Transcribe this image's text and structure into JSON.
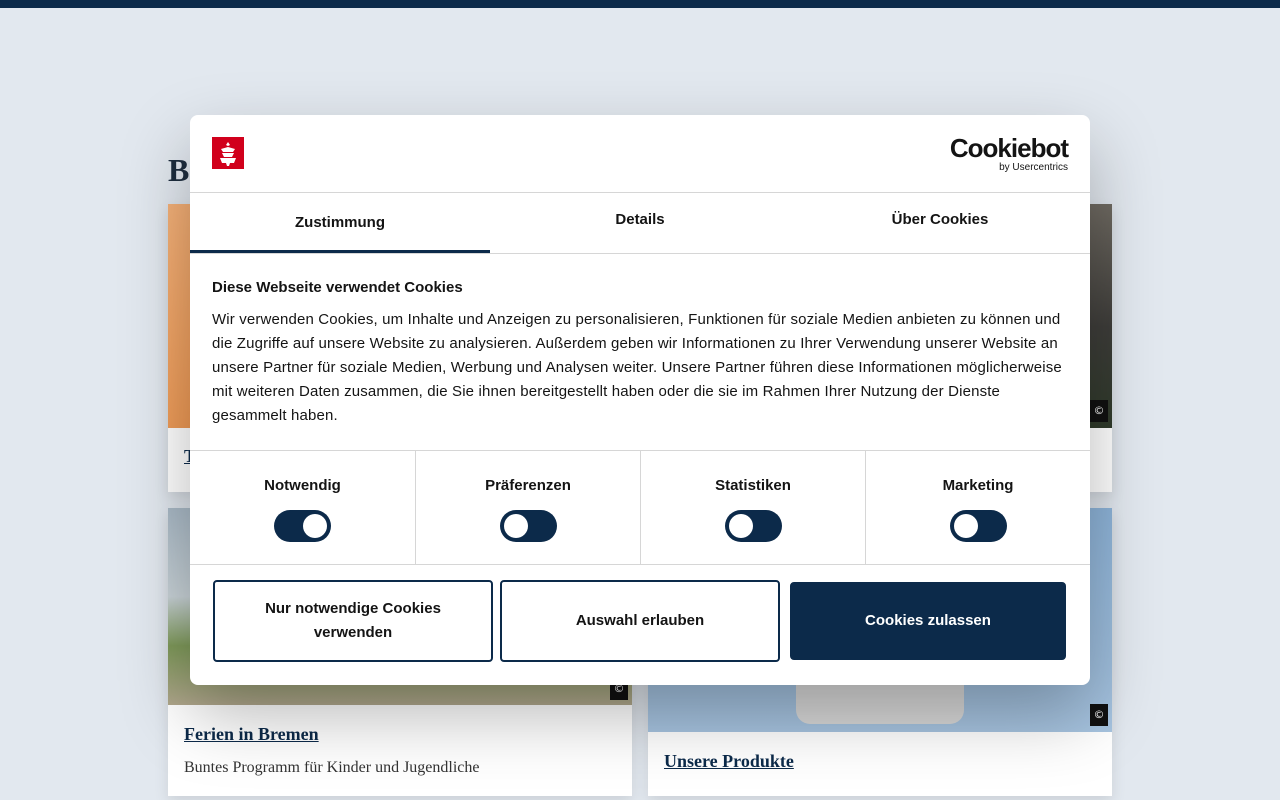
{
  "background": {
    "heading_initial": "B",
    "cards": [
      {
        "title": "T",
        "subtitle": ""
      },
      {
        "title": "",
        "subtitle": ""
      },
      {
        "title": "Ferien in Bremen",
        "subtitle": "Buntes Programm für Kinder und Jugendliche"
      },
      {
        "title": "Unsere Produkte",
        "subtitle": ""
      }
    ],
    "copyright_symbol": "©"
  },
  "dialog": {
    "logo_alt": "Bremen coat of arms logo",
    "brand_name": "Cookiebot",
    "brand_by": "by Usercentrics",
    "tabs": [
      {
        "label": "Zustimmung",
        "active": true
      },
      {
        "label": "Details",
        "active": false
      },
      {
        "label": "Über Cookies",
        "active": false
      }
    ],
    "title": "Diese Webseite verwendet Cookies",
    "body": "Wir verwenden Cookies, um Inhalte und Anzeigen zu personalisieren, Funktionen für soziale Medien anbieten zu können und die Zugriffe auf unsere Website zu analysieren. Außerdem geben wir Informationen zu Ihrer Verwendung unserer Website an unsere Partner für soziale Medien, Werbung und Analysen weiter. Unsere Partner führen diese Informationen möglicherweise mit weiteren Daten zusammen, die Sie ihnen bereitgestellt haben oder die sie im Rahmen Ihrer Nutzung der Dienste gesammelt haben.",
    "toggles": [
      {
        "label": "Notwendig",
        "on": true
      },
      {
        "label": "Präferenzen",
        "on": false
      },
      {
        "label": "Statistiken",
        "on": false
      },
      {
        "label": "Marketing",
        "on": false
      }
    ],
    "buttons": {
      "necessary_only": "Nur notwendige Cookies verwenden",
      "allow_selection": "Auswahl erlauben",
      "allow_all": "Cookies zulassen"
    }
  },
  "colors": {
    "accent": "#0c2a4a",
    "brand_red": "#d1001c",
    "page_bg": "#e2e8ef"
  }
}
